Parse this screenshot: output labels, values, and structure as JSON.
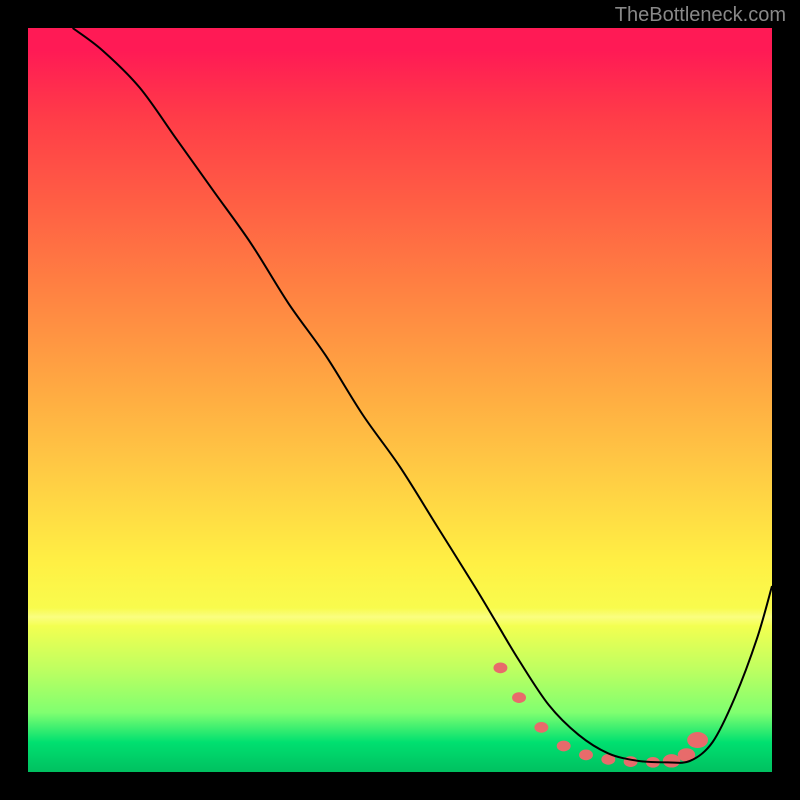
{
  "watermark": "TheBottleneck.com",
  "chart_data": {
    "type": "line",
    "title": "",
    "xlabel": "",
    "ylabel": "",
    "xlim": [
      0,
      100
    ],
    "ylim": [
      0,
      100
    ],
    "grid": false,
    "series": [
      {
        "name": "curve",
        "color": "#000000",
        "x": [
          6,
          10,
          15,
          20,
          25,
          30,
          35,
          40,
          45,
          50,
          55,
          60,
          63,
          66,
          70,
          74,
          78,
          82,
          86,
          89,
          92,
          95,
          98,
          100
        ],
        "values": [
          100,
          97,
          92,
          85,
          78,
          71,
          63,
          56,
          48,
          41,
          33,
          25,
          20,
          15,
          9,
          5,
          2.5,
          1.5,
          1.3,
          1.5,
          4,
          10,
          18,
          25
        ]
      }
    ],
    "markers": {
      "name": "dots",
      "color": "#e86b6b",
      "x": [
        63.5,
        66,
        69,
        72,
        75,
        78,
        81,
        84,
        86.5,
        88.5,
        90
      ],
      "y": [
        14,
        10,
        6,
        3.5,
        2.3,
        1.7,
        1.4,
        1.3,
        1.5,
        2.3,
        4.3
      ],
      "size": [
        4,
        4,
        4,
        4,
        4,
        4,
        4,
        4,
        5,
        5,
        6
      ]
    },
    "gradient_stops": [
      {
        "pos": 0,
        "color": "#ff1a55"
      },
      {
        "pos": 0.5,
        "color": "#ffcc44"
      },
      {
        "pos": 0.82,
        "color": "#f6ff50"
      },
      {
        "pos": 1.0,
        "color": "#00c060"
      }
    ]
  }
}
